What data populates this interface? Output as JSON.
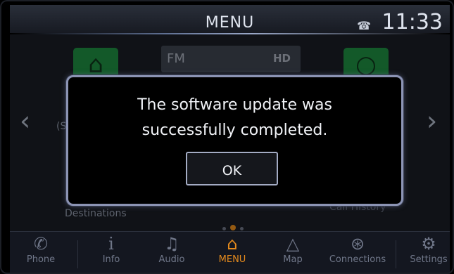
{
  "header": {
    "title": "MENU",
    "time": "11:33",
    "status_icon": "phone-link-icon"
  },
  "background": {
    "fm_label": "FM",
    "hd_label": "HD",
    "left_partial_text": "(S",
    "destinations_label": "Destinations",
    "call_history_label": "Call History",
    "left_tile_icon": "home-icon",
    "right_tile_icon": "circle-icon"
  },
  "dialog": {
    "message_line1": "The software update was",
    "message_line2": "successfully completed.",
    "ok_label": "OK"
  },
  "dock": {
    "items": [
      {
        "label": "Phone",
        "icon": "phone-icon"
      },
      {
        "label": "Info",
        "icon": "info-icon"
      },
      {
        "label": "Audio",
        "icon": "music-note-icon"
      },
      {
        "label": "MENU",
        "icon": "home-icon",
        "active": true
      },
      {
        "label": "Map",
        "icon": "navigation-arrow-icon"
      },
      {
        "label": "Connections",
        "icon": "bluetooth-wifi-icon"
      },
      {
        "label": "Settings",
        "icon": "gear-icon"
      }
    ]
  },
  "colors": {
    "accent": "#e48a1d",
    "tile_green": "#1f9c46",
    "modal_border": "#8c94b4"
  }
}
